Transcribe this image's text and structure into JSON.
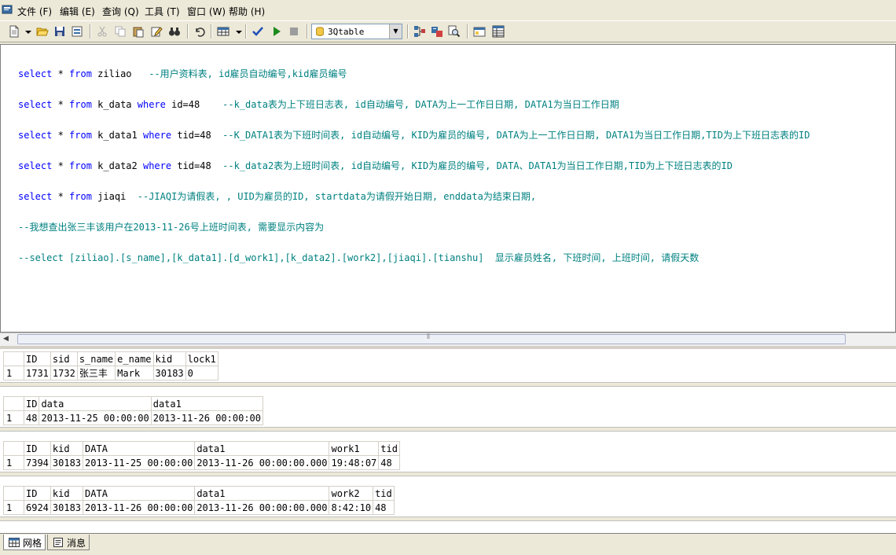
{
  "menu": {
    "items": [
      "文件 (F)",
      "编辑 (E)",
      "查询 (Q)",
      "工具 (T)",
      "窗口 (W)",
      "帮助 (H)"
    ]
  },
  "toolbar": {
    "database": "3Qtable"
  },
  "editor": {
    "lines": [
      {
        "kw1": "select",
        "t1": " * ",
        "kw2": "from",
        "t2": " ziliao   ",
        "kw3": "",
        "t3": "",
        "cm": "--用户资料表, id雇员自动编号,kid雇员编号"
      },
      {
        "kw1": "select",
        "t1": " * ",
        "kw2": "from",
        "t2": " k_data ",
        "kw3": "where",
        "t3": " id=48    ",
        "cm": "--k_data表为上下班日志表, id自动编号, DATA为上一工作日日期, DATA1为当日工作日期"
      },
      {
        "kw1": "select",
        "t1": " * ",
        "kw2": "from",
        "t2": " k_data1 ",
        "kw3": "where",
        "t3": " tid=48  ",
        "cm": "--K_DATA1表为下班时间表, id自动编号, KID为雇员的编号, DATA为上一工作日日期, DATA1为当日工作日期,TID为上下班日志表的ID"
      },
      {
        "kw1": "select",
        "t1": " * ",
        "kw2": "from",
        "t2": " k_data2 ",
        "kw3": "where",
        "t3": " tid=48  ",
        "cm": "--k_data2表为上班时间表, id自动编号, KID为雇员的编号, DATA、DATA1为当日工作日期,TID为上下班日志表的ID"
      },
      {
        "kw1": "select",
        "t1": " * ",
        "kw2": "from",
        "t2": " jiaqi  ",
        "kw3": "",
        "t3": "",
        "cm": "--JIAQI为请假表, , UID为雇员的ID, startdata为请假开始日期, enddata为结束日期,"
      },
      {
        "kw1": "",
        "t1": "",
        "kw2": "",
        "t2": "",
        "kw3": "",
        "t3": "",
        "cm": "--我想查出张三丰该用户在2013-11-26号上班时间表, 需要显示内容为"
      },
      {
        "kw1": "",
        "t1": "",
        "kw2": "",
        "t2": "",
        "kw3": "",
        "t3": "",
        "cm": "--select [ziliao].[s_name],[k_data1].[d_work1],[k_data2].[work2],[jiaqi].[tianshu]  显示雇员姓名, 下班时间, 上班时间, 请假天数"
      }
    ]
  },
  "results": [
    {
      "headers": [
        "ID",
        "sid",
        "s_name",
        "e_name",
        "kid",
        "lock1"
      ],
      "rows": [
        [
          "1",
          "1731",
          "1732",
          "张三丰",
          "Mark",
          "30183",
          "0"
        ]
      ]
    },
    {
      "headers": [
        "ID",
        "data",
        "data1"
      ],
      "rows": [
        [
          "1",
          "48",
          "2013-11-25 00:00:00",
          "2013-11-26 00:00:00"
        ]
      ]
    },
    {
      "headers": [
        "ID",
        "kid",
        "DATA",
        "data1",
        "work1",
        "tid"
      ],
      "rows": [
        [
          "1",
          "7394",
          "30183",
          "2013-11-25 00:00:00",
          "2013-11-26 00:00:00.000",
          "19:48:07",
          "48"
        ]
      ]
    },
    {
      "headers": [
        "ID",
        "kid",
        "DATA",
        "data1",
        "work2",
        "tid"
      ],
      "rows": [
        [
          "1",
          "6924",
          "30183",
          "2013-11-26 00:00:00",
          "2013-11-26 00:00:00.000",
          "8:42:10",
          "48"
        ]
      ]
    }
  ],
  "tabs": {
    "grid": "网格",
    "messages": "消息"
  }
}
